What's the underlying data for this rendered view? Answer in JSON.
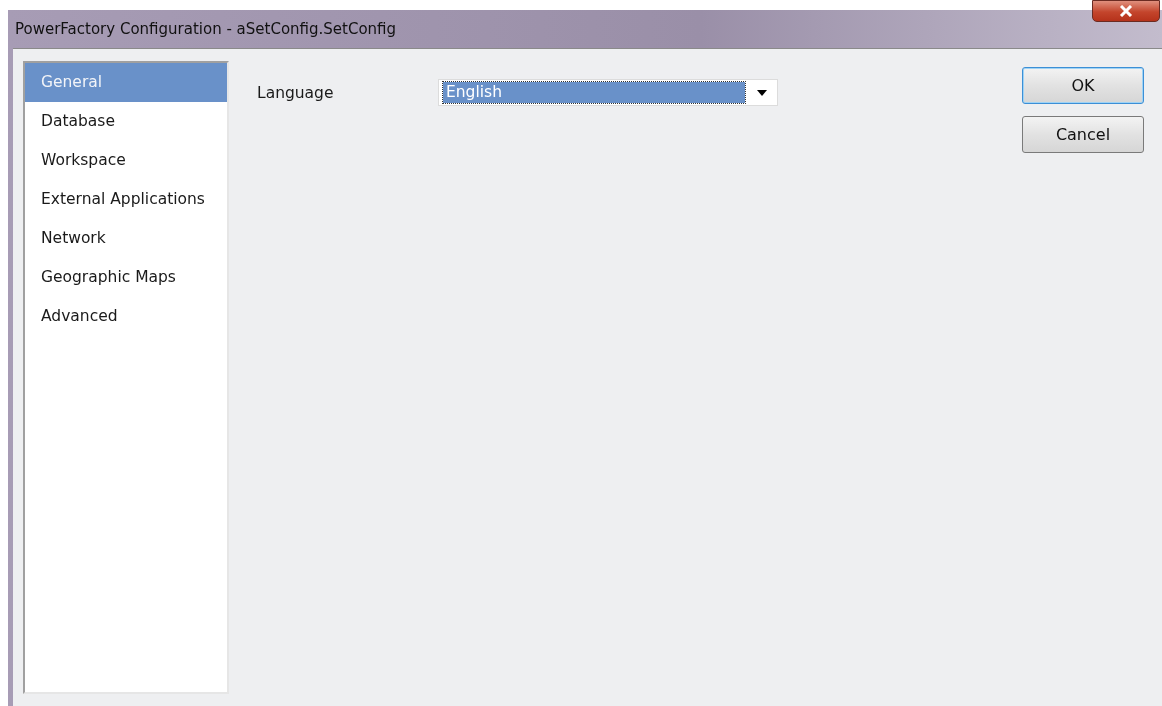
{
  "window": {
    "title": "PowerFactory Configuration - aSetConfig.SetConfig"
  },
  "sidebar": {
    "items": [
      {
        "label": "General",
        "selected": true
      },
      {
        "label": "Database",
        "selected": false
      },
      {
        "label": "Workspace",
        "selected": false
      },
      {
        "label": "External Applications",
        "selected": false
      },
      {
        "label": "Network",
        "selected": false
      },
      {
        "label": "Geographic Maps",
        "selected": false
      },
      {
        "label": "Advanced",
        "selected": false
      }
    ]
  },
  "language": {
    "label": "Language",
    "value": "English"
  },
  "buttons": [
    {
      "label": "OK",
      "kind": "default"
    },
    {
      "label": "Cancel",
      "kind": "normal"
    }
  ]
}
